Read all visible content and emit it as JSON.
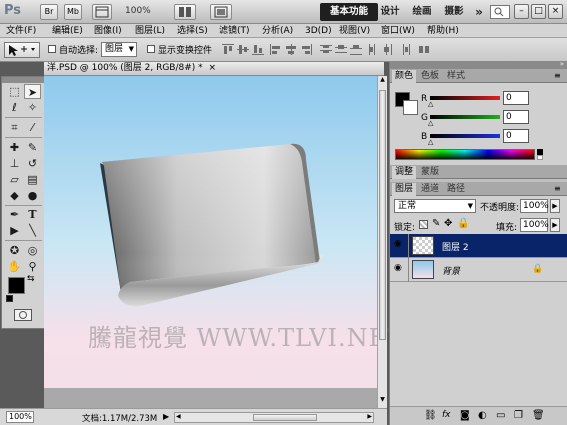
{
  "appbar": {
    "logo": "Ps",
    "btn_br": "Br",
    "btn_mb": "Mb",
    "zoom": "100%",
    "workspaces": [
      "基本功能",
      "设计",
      "绘画",
      "摄影"
    ],
    "more": "»",
    "ctrl_min": "–",
    "ctrl_max": "□",
    "ctrl_close": "×"
  },
  "menu": [
    "文件(F)",
    "编辑(E)",
    "图像(I)",
    "图层(L)",
    "选择(S)",
    "滤镜(T)",
    "分析(A)",
    "3D(D)",
    "视图(V)",
    "窗口(W)",
    "帮助(H)"
  ],
  "options": {
    "auto_select_label": "自动选择:",
    "auto_select_value": "图层",
    "show_transform_label": "显示变换控件"
  },
  "document": {
    "tab_title": "洋.PSD @ 100% (图层 2, RGB/8#) *",
    "tab_close": "×",
    "watermark": "騰龍視覺 WWW.TLVI.NET",
    "status_zoom": "100%",
    "status_doc": "文档:1.17M/2.73M"
  },
  "color_panel": {
    "tabs": [
      "颜色",
      "色板",
      "样式"
    ],
    "channels": [
      {
        "name": "R",
        "value": "0",
        "color": "#e02020"
      },
      {
        "name": "G",
        "value": "0",
        "color": "#20b020"
      },
      {
        "name": "B",
        "value": "0",
        "color": "#2030e0"
      }
    ]
  },
  "adjust_panel": {
    "tabs": [
      "调整",
      "蒙版"
    ]
  },
  "layers_panel": {
    "tabs": [
      "图层",
      "通道",
      "路径"
    ],
    "blend_mode": "正常",
    "opacity_label": "不透明度:",
    "opacity_value": "100%",
    "lock_label": "锁定:",
    "fill_label": "填充:",
    "fill_value": "100%",
    "layers": [
      {
        "name": "图层 2",
        "selected": true
      },
      {
        "name": "背景",
        "selected": false
      }
    ]
  },
  "colors": {
    "accent": "#0a246a",
    "foreground": "#000000",
    "background": "#ffffff"
  }
}
